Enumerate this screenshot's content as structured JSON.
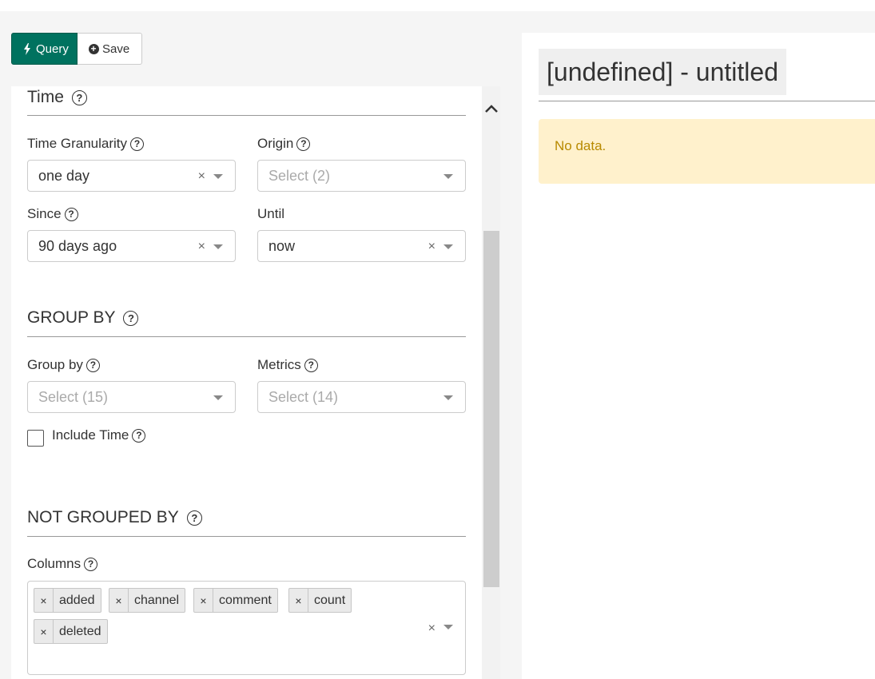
{
  "toolbar": {
    "query_label": "Query",
    "save_label": "Save"
  },
  "sections": {
    "time": {
      "title": "Time",
      "time_granularity": {
        "label": "Time Granularity",
        "value": "one day"
      },
      "origin": {
        "label": "Origin",
        "placeholder": "Select (2)"
      },
      "since": {
        "label": "Since",
        "value": "90 days ago"
      },
      "until": {
        "label": "Until",
        "value": "now"
      }
    },
    "group_by": {
      "title": "GROUP BY",
      "group_by": {
        "label": "Group by",
        "placeholder": "Select (15)"
      },
      "metrics": {
        "label": "Metrics",
        "placeholder": "Select (14)"
      },
      "include_time": {
        "label": "Include Time",
        "checked": false
      }
    },
    "not_grouped_by": {
      "title": "NOT GROUPED BY",
      "columns": {
        "label": "Columns",
        "selected": [
          "added",
          "channel",
          "comment",
          "count",
          "deleted"
        ]
      }
    }
  },
  "chart": {
    "title": "[undefined] - untitled",
    "alert": "No data."
  },
  "icons": {
    "query": "bolt-icon",
    "save": "plus-circle-icon",
    "help": "question-circle-icon",
    "clear": "times-icon",
    "caret": "caret-down-icon",
    "scroll_up": "chevron-up-icon"
  },
  "colors": {
    "query_button": "#00725f",
    "alert_background": "#fff1cc",
    "alert_text": "#b88a00"
  }
}
